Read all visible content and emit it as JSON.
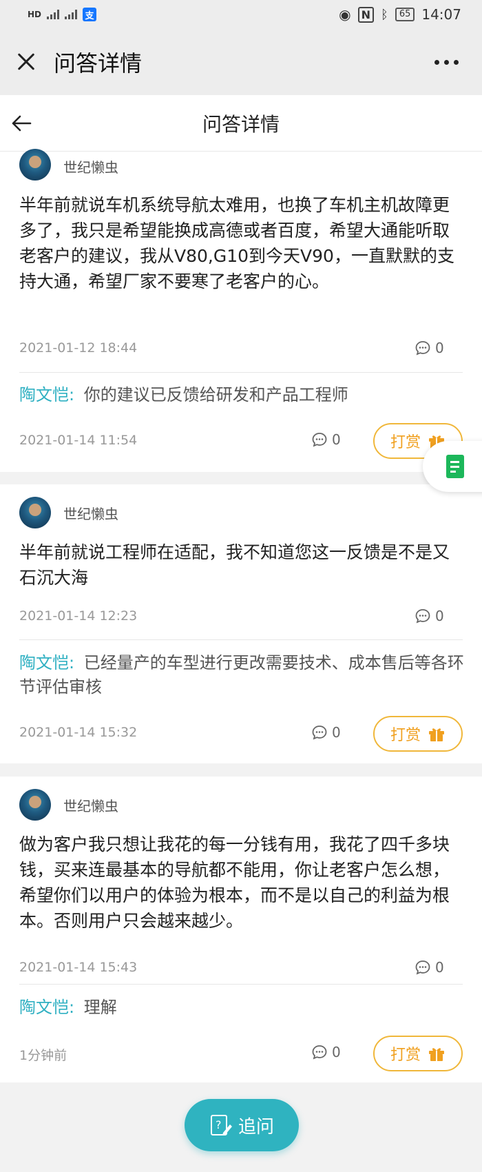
{
  "status_bar": {
    "left_badges": [
      "HD",
      "2",
      "4G",
      "4G"
    ],
    "battery": "65",
    "time": "14:07"
  },
  "wechat_bar": {
    "title": "问答详情"
  },
  "page_header": {
    "title": "问答详情"
  },
  "threads": [
    {
      "user": "世纪懒虫",
      "question": "半年前就说车机系统导航太难用，也换了车机主机故障更多了，我只是希望能换成高德或者百度，希望大通能听取老客户的建议，我从V80,G10到今天V90，一直默默的支持大通，希望厂家不要寒了老客户的心。",
      "question_date": "2021-01-12 18:44",
      "question_comments": "0",
      "answer_who": "陶文恺:",
      "answer_text": "你的建议已反馈给研发和产品工程师",
      "answer_date": "2021-01-14 11:54",
      "answer_comments": "0",
      "reward_label": "打赏"
    },
    {
      "user": "世纪懒虫",
      "question": "半年前就说工程师在适配，我不知道您这一反馈是不是又石沉大海",
      "question_date": "2021-01-14 12:23",
      "question_comments": "0",
      "answer_who": "陶文恺:",
      "answer_text": "已经量产的车型进行更改需要技术、成本售后等各环节评估审核",
      "answer_date": "2021-01-14 15:32",
      "answer_comments": "0",
      "reward_label": "打赏"
    },
    {
      "user": "世纪懒虫",
      "question": "做为客户我只想让我花的每一分钱有用，我花了四千多块钱，买来连最基本的导航都不能用，你让老客户怎么想，希望你们以用户的体验为根本，而不是以自己的利益为根本。否则用户只会越来越少。",
      "question_date": "2021-01-14 15:43",
      "question_comments": "0",
      "answer_who": "陶文恺:",
      "answer_text": "理解",
      "answer_date": "1分钟前",
      "answer_comments": "0",
      "reward_label": "打赏"
    }
  ],
  "ask_button": {
    "label": "追问"
  },
  "colors": {
    "accent": "#2fb3c0",
    "answer_name": "#2fb0c2",
    "reward": "#f0b73a",
    "doc_fab": "#1cb75a"
  }
}
